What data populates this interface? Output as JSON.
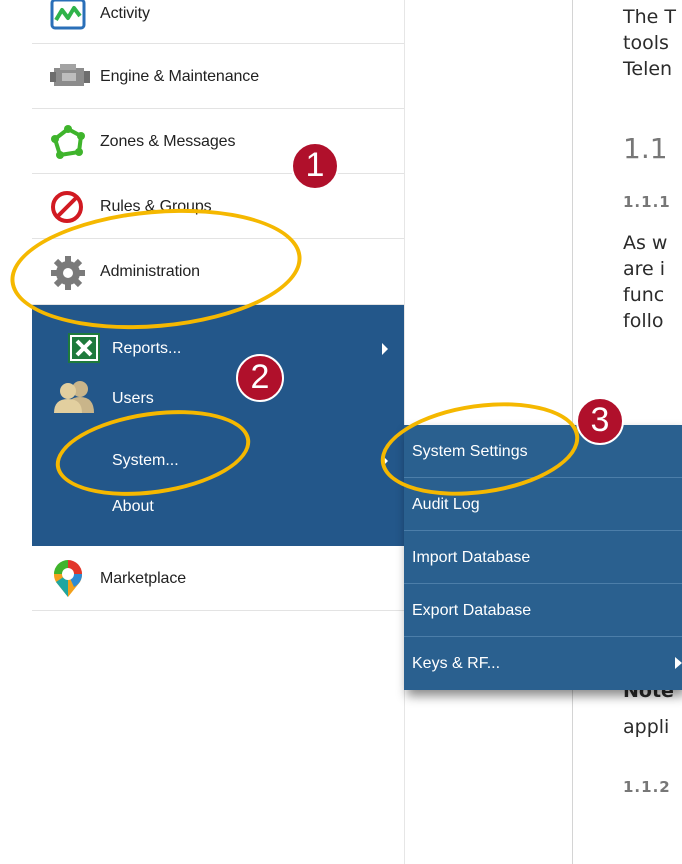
{
  "sidebar": {
    "items": [
      {
        "label": "Activity",
        "icon": "activity-chart-icon"
      },
      {
        "label": "Engine & Maintenance",
        "icon": "engine-icon"
      },
      {
        "label": "Zones & Messages",
        "icon": "zones-icon"
      },
      {
        "label": "Rules & Groups",
        "icon": "rules-prohibited-icon"
      },
      {
        "label": "Administration",
        "icon": "gear-icon"
      },
      {
        "label": "Marketplace",
        "icon": "marketplace-pin-icon"
      }
    ],
    "admin_submenu": [
      {
        "label": "Reports...",
        "icon": "excel-icon",
        "has_submenu": true
      },
      {
        "label": "Users",
        "icon": "users-icon",
        "has_submenu": false
      },
      {
        "label": "System...",
        "has_submenu": true
      },
      {
        "label": "About",
        "has_submenu": false
      }
    ]
  },
  "flyout": {
    "items": [
      {
        "label": "System Settings"
      },
      {
        "label": "Audit Log"
      },
      {
        "label": "Import Database"
      },
      {
        "label": "Export Database"
      },
      {
        "label": "Keys & RF...",
        "has_submenu": true
      }
    ]
  },
  "document": {
    "lines": [
      "The T",
      "tools",
      "Telen",
      "1.1",
      "1.1.1",
      "As w",
      "are i",
      "func",
      "follo",
      "Note",
      "appli",
      "1.1.2"
    ]
  },
  "annotations": {
    "badges": [
      "1",
      "2",
      "3"
    ]
  },
  "colors": {
    "submenu_bg": "#23578a",
    "flyout_bg": "#2a608f",
    "highlight_ring": "#f5b800",
    "badge_bg": "#b0102b"
  }
}
